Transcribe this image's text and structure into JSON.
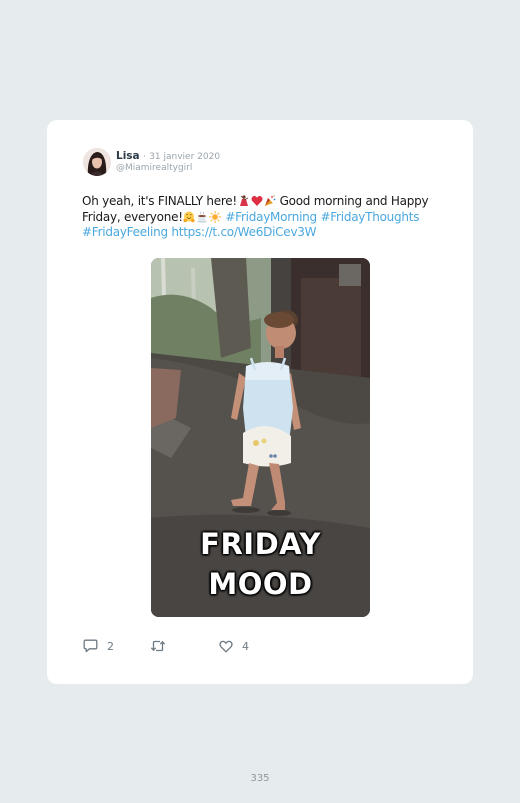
{
  "tweet": {
    "author_name": "Lisa",
    "separator": "·",
    "date": "31 janvier 2020",
    "handle": "@Miamirealtygirl",
    "text_part1": "Oh yeah, it's FINALLY here!",
    "text_part2": " Good morning and Happy Friday, everyone!",
    "hashtag1": "#FridayMorning",
    "hashtag2": "#FridayThoughts",
    "hashtag3": "#FridayFeeling",
    "link": "https://t.co/We6DiCev3W",
    "emojis_group1": [
      "dancer-emoji",
      "heart-emoji",
      "party-popper-emoji"
    ],
    "emojis_group2": [
      "hugging-face-emoji",
      "coffee-emoji",
      "sun-emoji"
    ],
    "media": {
      "caption_line1": "FRIDAY",
      "caption_line2": "MOOD"
    },
    "actions": {
      "reply_count": "2",
      "retweet_count": "",
      "like_count": "4"
    }
  },
  "page": {
    "number": "335"
  },
  "colors": {
    "background": "#e6ebee",
    "card": "#ffffff",
    "hashtag": "#4aa8e0",
    "muted": "#9aa5ad"
  }
}
